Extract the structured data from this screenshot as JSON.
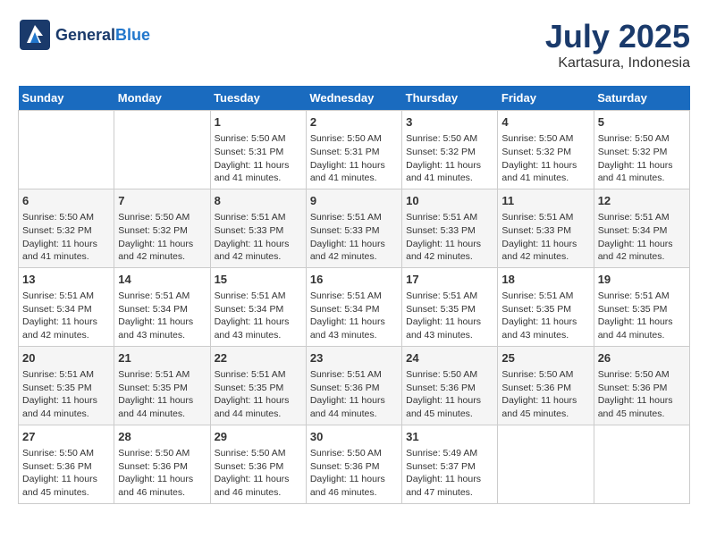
{
  "header": {
    "logo_general": "General",
    "logo_blue": "Blue",
    "title": "July 2025",
    "subtitle": "Kartasura, Indonesia"
  },
  "days_of_week": [
    "Sunday",
    "Monday",
    "Tuesday",
    "Wednesday",
    "Thursday",
    "Friday",
    "Saturday"
  ],
  "weeks": [
    [
      {
        "num": "",
        "content": ""
      },
      {
        "num": "",
        "content": ""
      },
      {
        "num": "1",
        "content": "Sunrise: 5:50 AM\nSunset: 5:31 PM\nDaylight: 11 hours\nand 41 minutes."
      },
      {
        "num": "2",
        "content": "Sunrise: 5:50 AM\nSunset: 5:31 PM\nDaylight: 11 hours\nand 41 minutes."
      },
      {
        "num": "3",
        "content": "Sunrise: 5:50 AM\nSunset: 5:32 PM\nDaylight: 11 hours\nand 41 minutes."
      },
      {
        "num": "4",
        "content": "Sunrise: 5:50 AM\nSunset: 5:32 PM\nDaylight: 11 hours\nand 41 minutes."
      },
      {
        "num": "5",
        "content": "Sunrise: 5:50 AM\nSunset: 5:32 PM\nDaylight: 11 hours\nand 41 minutes."
      }
    ],
    [
      {
        "num": "6",
        "content": "Sunrise: 5:50 AM\nSunset: 5:32 PM\nDaylight: 11 hours\nand 41 minutes."
      },
      {
        "num": "7",
        "content": "Sunrise: 5:50 AM\nSunset: 5:32 PM\nDaylight: 11 hours\nand 42 minutes."
      },
      {
        "num": "8",
        "content": "Sunrise: 5:51 AM\nSunset: 5:33 PM\nDaylight: 11 hours\nand 42 minutes."
      },
      {
        "num": "9",
        "content": "Sunrise: 5:51 AM\nSunset: 5:33 PM\nDaylight: 11 hours\nand 42 minutes."
      },
      {
        "num": "10",
        "content": "Sunrise: 5:51 AM\nSunset: 5:33 PM\nDaylight: 11 hours\nand 42 minutes."
      },
      {
        "num": "11",
        "content": "Sunrise: 5:51 AM\nSunset: 5:33 PM\nDaylight: 11 hours\nand 42 minutes."
      },
      {
        "num": "12",
        "content": "Sunrise: 5:51 AM\nSunset: 5:34 PM\nDaylight: 11 hours\nand 42 minutes."
      }
    ],
    [
      {
        "num": "13",
        "content": "Sunrise: 5:51 AM\nSunset: 5:34 PM\nDaylight: 11 hours\nand 42 minutes."
      },
      {
        "num": "14",
        "content": "Sunrise: 5:51 AM\nSunset: 5:34 PM\nDaylight: 11 hours\nand 43 minutes."
      },
      {
        "num": "15",
        "content": "Sunrise: 5:51 AM\nSunset: 5:34 PM\nDaylight: 11 hours\nand 43 minutes."
      },
      {
        "num": "16",
        "content": "Sunrise: 5:51 AM\nSunset: 5:34 PM\nDaylight: 11 hours\nand 43 minutes."
      },
      {
        "num": "17",
        "content": "Sunrise: 5:51 AM\nSunset: 5:35 PM\nDaylight: 11 hours\nand 43 minutes."
      },
      {
        "num": "18",
        "content": "Sunrise: 5:51 AM\nSunset: 5:35 PM\nDaylight: 11 hours\nand 43 minutes."
      },
      {
        "num": "19",
        "content": "Sunrise: 5:51 AM\nSunset: 5:35 PM\nDaylight: 11 hours\nand 44 minutes."
      }
    ],
    [
      {
        "num": "20",
        "content": "Sunrise: 5:51 AM\nSunset: 5:35 PM\nDaylight: 11 hours\nand 44 minutes."
      },
      {
        "num": "21",
        "content": "Sunrise: 5:51 AM\nSunset: 5:35 PM\nDaylight: 11 hours\nand 44 minutes."
      },
      {
        "num": "22",
        "content": "Sunrise: 5:51 AM\nSunset: 5:35 PM\nDaylight: 11 hours\nand 44 minutes."
      },
      {
        "num": "23",
        "content": "Sunrise: 5:51 AM\nSunset: 5:36 PM\nDaylight: 11 hours\nand 44 minutes."
      },
      {
        "num": "24",
        "content": "Sunrise: 5:50 AM\nSunset: 5:36 PM\nDaylight: 11 hours\nand 45 minutes."
      },
      {
        "num": "25",
        "content": "Sunrise: 5:50 AM\nSunset: 5:36 PM\nDaylight: 11 hours\nand 45 minutes."
      },
      {
        "num": "26",
        "content": "Sunrise: 5:50 AM\nSunset: 5:36 PM\nDaylight: 11 hours\nand 45 minutes."
      }
    ],
    [
      {
        "num": "27",
        "content": "Sunrise: 5:50 AM\nSunset: 5:36 PM\nDaylight: 11 hours\nand 45 minutes."
      },
      {
        "num": "28",
        "content": "Sunrise: 5:50 AM\nSunset: 5:36 PM\nDaylight: 11 hours\nand 46 minutes."
      },
      {
        "num": "29",
        "content": "Sunrise: 5:50 AM\nSunset: 5:36 PM\nDaylight: 11 hours\nand 46 minutes."
      },
      {
        "num": "30",
        "content": "Sunrise: 5:50 AM\nSunset: 5:36 PM\nDaylight: 11 hours\nand 46 minutes."
      },
      {
        "num": "31",
        "content": "Sunrise: 5:49 AM\nSunset: 5:37 PM\nDaylight: 11 hours\nand 47 minutes."
      },
      {
        "num": "",
        "content": ""
      },
      {
        "num": "",
        "content": ""
      }
    ]
  ]
}
